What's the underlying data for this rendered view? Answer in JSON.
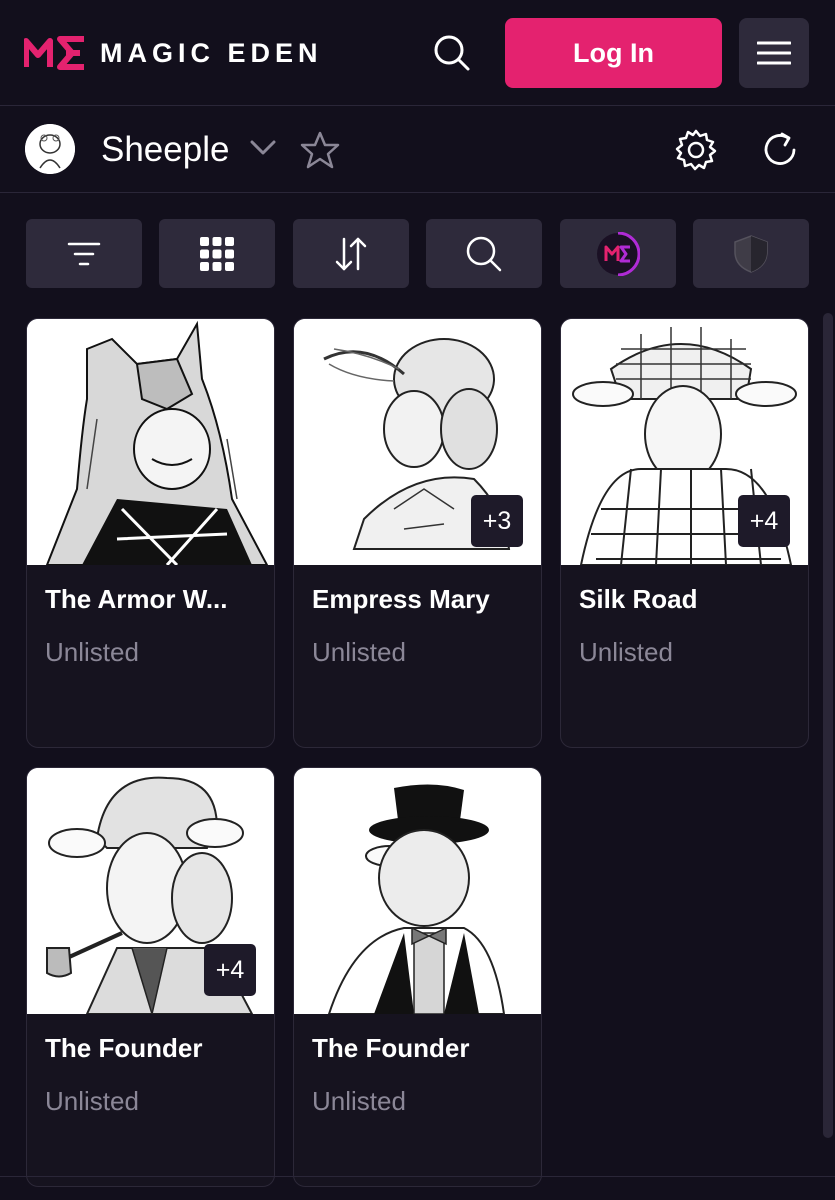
{
  "header": {
    "brand": "MAGIC EDEN",
    "login_label": "Log In",
    "search_icon": "search-icon",
    "menu_icon": "hamburger-menu-icon"
  },
  "collection": {
    "name": "Sheeple",
    "icons": [
      "chevron-down-icon",
      "star-icon",
      "gear-icon",
      "refresh-icon"
    ]
  },
  "toolbar": {
    "tools": [
      "filter-icon",
      "grid-view-icon",
      "sort-icon",
      "search-icon",
      "magic-eden-icon",
      "shield-icon"
    ]
  },
  "items": [
    {
      "title": "The Armor W...",
      "status": "Unlisted",
      "badge": "",
      "art": "wolf-cloak-sheep"
    },
    {
      "title": "Empress Mary",
      "status": "Unlisted",
      "badge": "+3",
      "art": "baroque-sheep"
    },
    {
      "title": "Silk Road",
      "status": "Unlisted",
      "badge": "+4",
      "art": "keffiyeh-sheep"
    },
    {
      "title": "The Founder",
      "status": "Unlisted",
      "badge": "+4",
      "art": "pipe-sheep"
    },
    {
      "title": "The Founder",
      "status": "Unlisted",
      "badge": "",
      "art": "top-hat-sheep"
    }
  ],
  "colors": {
    "background": "#120f1c",
    "accent": "#e4226f",
    "surface": "#2e2a3b",
    "muted_text": "#8b8797"
  }
}
